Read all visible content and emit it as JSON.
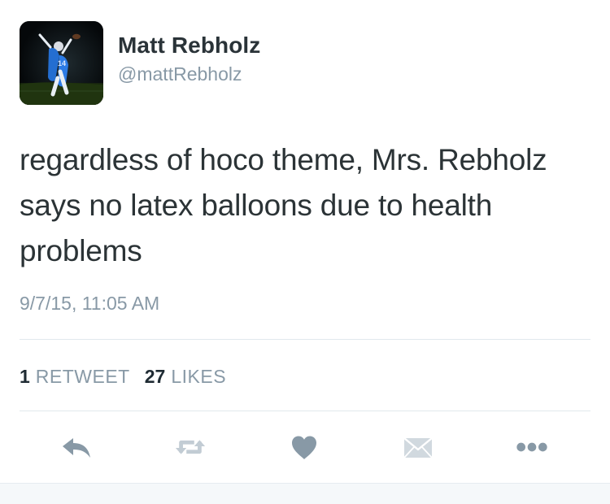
{
  "user": {
    "name": "Matt Rebholz",
    "handle": "@mattRebholz",
    "avatar_icon": "profile-photo-football-player-icon"
  },
  "tweet": {
    "text": "regardless of hoco theme, Mrs. Rebholz says no latex balloons due to health problems",
    "timestamp": "9/7/15, 11:05 AM"
  },
  "stats": {
    "retweets_count": "1",
    "retweets_label": "RETWEET",
    "likes_count": "27",
    "likes_label": "LIKES"
  },
  "actions": [
    {
      "name": "reply",
      "icon": "reply-icon"
    },
    {
      "name": "retweet",
      "icon": "retweet-icon"
    },
    {
      "name": "like",
      "icon": "heart-icon"
    },
    {
      "name": "direct-message",
      "icon": "envelope-icon"
    },
    {
      "name": "more",
      "icon": "more-dots-icon"
    }
  ],
  "colors": {
    "name": "#2a3338",
    "secondary_text": "#8899a6",
    "icon": "#8899a6",
    "divider": "#e1e8ed",
    "background": "#ffffff"
  }
}
